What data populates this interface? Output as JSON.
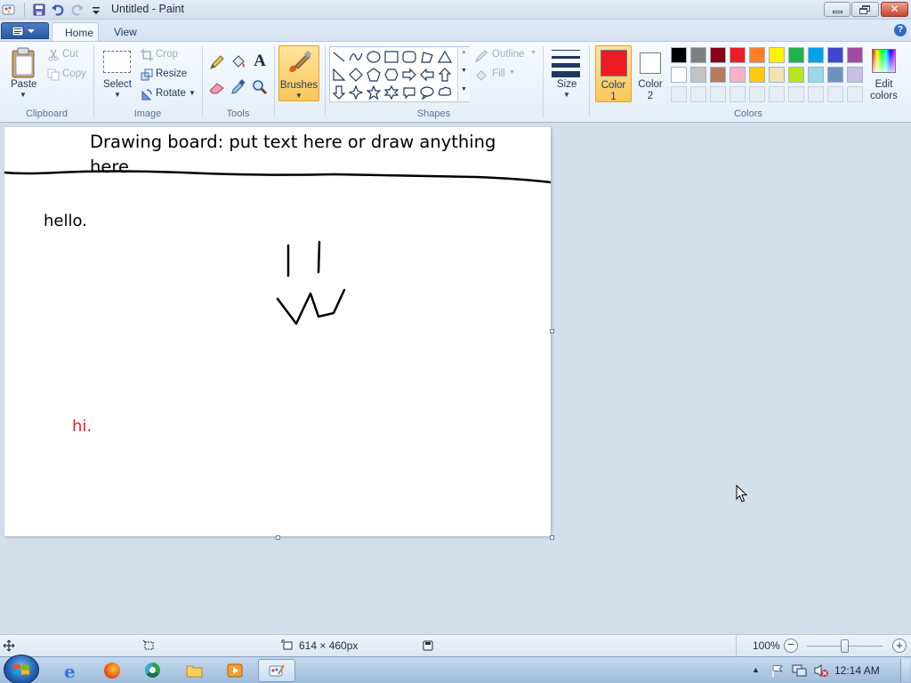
{
  "window": {
    "title": "Untitled - Paint"
  },
  "tabs": [
    {
      "label": "Home"
    },
    {
      "label": "View"
    }
  ],
  "ribbon": {
    "clipboard": {
      "group_label": "Clipboard",
      "paste": "Paste",
      "cut": "Cut",
      "copy": "Copy"
    },
    "image": {
      "group_label": "Image",
      "select": "Select",
      "crop": "Crop",
      "resize": "Resize",
      "rotate": "Rotate"
    },
    "tools": {
      "group_label": "Tools"
    },
    "brushes": {
      "label": "Brushes"
    },
    "shapes": {
      "group_label": "Shapes",
      "outline": "Outline",
      "fill": "Fill"
    },
    "size": {
      "label": "Size"
    },
    "colors": {
      "group_label": "Colors",
      "color1_label": "Color",
      "color1_num": "1",
      "color2_label": "Color",
      "color2_num": "2",
      "edit_label": "Edit",
      "edit_label2": "colors",
      "color1_value": "#ed1c24",
      "color2_value": "#ffffff",
      "palette_row1": [
        "#000000",
        "#7f7f7f",
        "#880015",
        "#ed1c24",
        "#ff7f27",
        "#fff200",
        "#22b14c",
        "#00a2e8",
        "#3f48cc",
        "#a349a4"
      ],
      "palette_row2": [
        "#ffffff",
        "#c3c3c3",
        "#b97a57",
        "#ffaec9",
        "#ffc90e",
        "#efe4b0",
        "#b5e61d",
        "#99d9ea",
        "#7092be",
        "#c8bfe7"
      ]
    }
  },
  "canvas": {
    "line1": "Drawing board: put text here or draw anything",
    "line2": "here.",
    "hello_text": "hello.",
    "hi_text": "hi.",
    "hi_color": "#ed1c24"
  },
  "status": {
    "image_size": "614 × 460px",
    "zoom": "100%"
  },
  "taskbar": {
    "time": "12:14 AM"
  }
}
